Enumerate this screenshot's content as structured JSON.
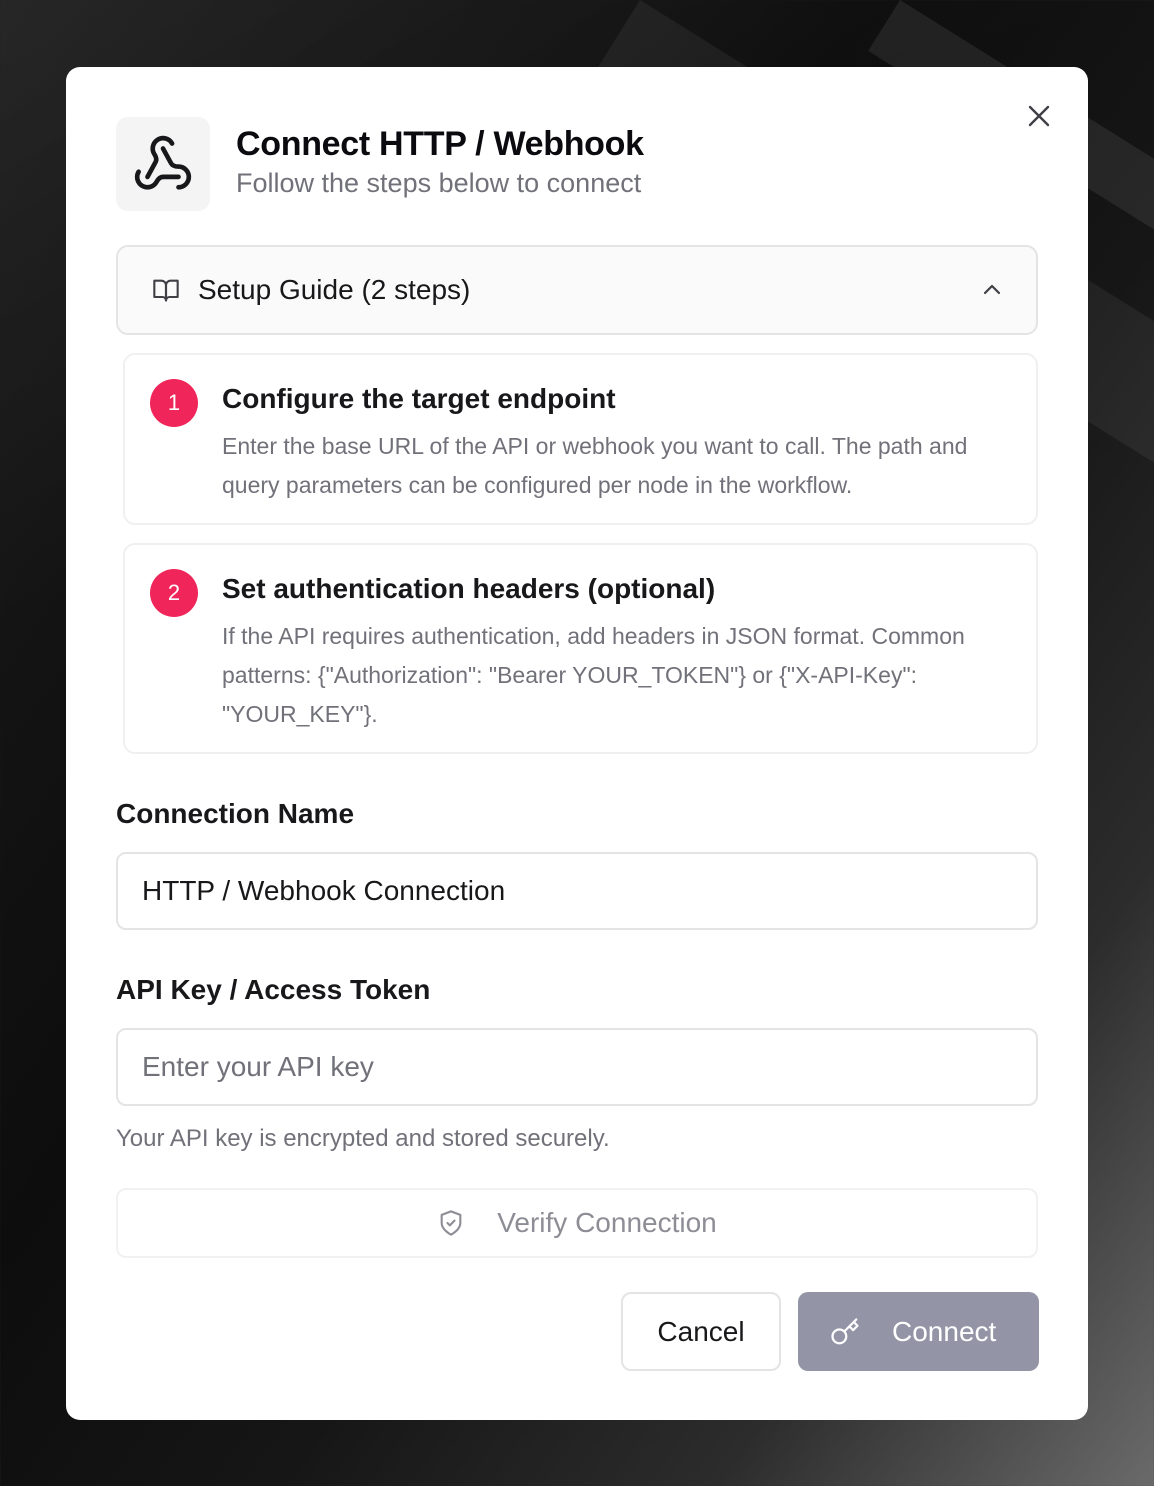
{
  "modal": {
    "title": "Connect HTTP / Webhook",
    "subtitle": "Follow the steps below to connect",
    "icon": "webhook-icon",
    "close_icon": "close-icon"
  },
  "guide": {
    "label": "Setup Guide (2 steps)",
    "icon": "book-icon",
    "toggle_icon": "chevron-up-icon",
    "expanded": true,
    "steps": [
      {
        "number": "1",
        "title": "Configure the target endpoint",
        "description": "Enter the base URL of the API or webhook you want to call. The path and query parameters can be configured per node in the workflow."
      },
      {
        "number": "2",
        "title": "Set authentication headers (optional)",
        "description": "If the API requires authentication, add headers in JSON format. Common patterns: {\"Authorization\": \"Bearer YOUR_TOKEN\"} or {\"X-API-Key\": \"YOUR_KEY\"}."
      }
    ]
  },
  "form": {
    "connection_name_label": "Connection Name",
    "connection_name_value": "HTTP / Webhook Connection",
    "api_key_label": "API Key / Access Token",
    "api_key_placeholder": "Enter your API key",
    "api_key_value": "",
    "api_key_help": "Your API key is encrypted and stored securely."
  },
  "actions": {
    "verify_label": "Verify Connection",
    "verify_icon": "shield-check-icon",
    "cancel_label": "Cancel",
    "connect_label": "Connect",
    "connect_icon": "key-icon"
  },
  "colors": {
    "accent": "#f0265a",
    "connect_button_disabled": "#9395a6",
    "text_primary": "#18181b",
    "text_muted": "#71717a"
  }
}
